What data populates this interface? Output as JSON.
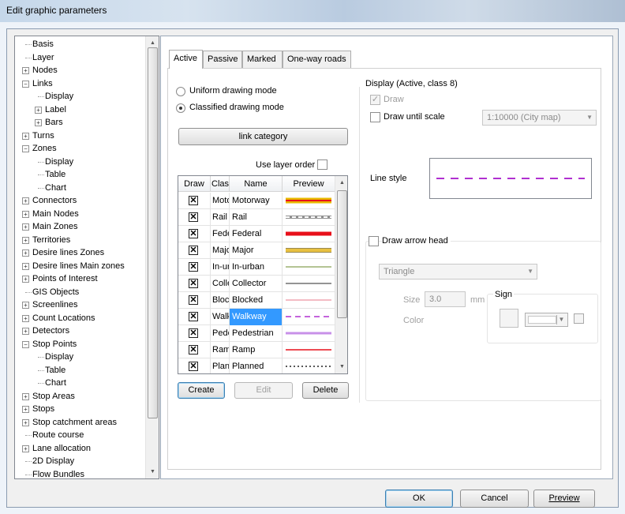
{
  "window": {
    "title": "Edit graphic parameters"
  },
  "tree": {
    "items": [
      {
        "label": "Basis",
        "level": 1,
        "expander": "none"
      },
      {
        "label": "Layer",
        "level": 1,
        "expander": "none"
      },
      {
        "label": "Nodes",
        "level": 1,
        "expander": "plus"
      },
      {
        "label": "Links",
        "level": 1,
        "expander": "minus"
      },
      {
        "label": "Display",
        "level": 2,
        "expander": "none"
      },
      {
        "label": "Label",
        "level": 2,
        "expander": "plus"
      },
      {
        "label": "Bars",
        "level": 2,
        "expander": "plus"
      },
      {
        "label": "Turns",
        "level": 1,
        "expander": "plus"
      },
      {
        "label": "Zones",
        "level": 1,
        "expander": "minus"
      },
      {
        "label": "Display",
        "level": 2,
        "expander": "none"
      },
      {
        "label": "Table",
        "level": 2,
        "expander": "none"
      },
      {
        "label": "Chart",
        "level": 2,
        "expander": "none"
      },
      {
        "label": "Connectors",
        "level": 1,
        "expander": "plus"
      },
      {
        "label": "Main Nodes",
        "level": 1,
        "expander": "plus"
      },
      {
        "label": "Main Zones",
        "level": 1,
        "expander": "plus"
      },
      {
        "label": "Territories",
        "level": 1,
        "expander": "plus"
      },
      {
        "label": "Desire lines Zones",
        "level": 1,
        "expander": "plus"
      },
      {
        "label": "Desire lines Main zones",
        "level": 1,
        "expander": "plus"
      },
      {
        "label": "Points of Interest",
        "level": 1,
        "expander": "plus"
      },
      {
        "label": "GIS Objects",
        "level": 1,
        "expander": "none"
      },
      {
        "label": "Screenlines",
        "level": 1,
        "expander": "plus"
      },
      {
        "label": "Count Locations",
        "level": 1,
        "expander": "plus"
      },
      {
        "label": "Detectors",
        "level": 1,
        "expander": "plus"
      },
      {
        "label": "Stop Points",
        "level": 1,
        "expander": "minus"
      },
      {
        "label": "Display",
        "level": 2,
        "expander": "none"
      },
      {
        "label": "Table",
        "level": 2,
        "expander": "none"
      },
      {
        "label": "Chart",
        "level": 2,
        "expander": "none"
      },
      {
        "label": "Stop Areas",
        "level": 1,
        "expander": "plus"
      },
      {
        "label": "Stops",
        "level": 1,
        "expander": "plus"
      },
      {
        "label": "Stop catchment areas",
        "level": 1,
        "expander": "plus"
      },
      {
        "label": "Route course",
        "level": 1,
        "expander": "none"
      },
      {
        "label": "Lane allocation",
        "level": 1,
        "expander": "plus"
      },
      {
        "label": "2D Display",
        "level": 1,
        "expander": "none"
      },
      {
        "label": "Flow Bundles",
        "level": 1,
        "expander": "none"
      }
    ]
  },
  "tabs": [
    {
      "label": "Active",
      "active": true
    },
    {
      "label": "Passive",
      "active": false
    },
    {
      "label": "Marked",
      "active": false
    },
    {
      "label": "One-way roads",
      "active": false
    }
  ],
  "mode": {
    "uniform_label": "Uniform drawing mode",
    "classified_label": "Classified drawing mode",
    "selected": "classified"
  },
  "link_category_button": "link category",
  "use_layer_order": {
    "label": "Use layer order",
    "checked": false
  },
  "grid": {
    "headers": {
      "draw": "Draw",
      "class": "Class",
      "name": "Name",
      "preview": "Preview"
    },
    "rows": [
      {
        "draw": true,
        "cls": "Motorway",
        "name": "Motorway",
        "preview": "motorway"
      },
      {
        "draw": true,
        "cls": "Rail",
        "name": "Rail",
        "preview": "rail"
      },
      {
        "draw": true,
        "cls": "Federal",
        "name": "Federal",
        "preview": "federal"
      },
      {
        "draw": true,
        "cls": "Major",
        "name": "Major",
        "preview": "major"
      },
      {
        "draw": true,
        "cls": "In-urban",
        "name": "In-urban",
        "preview": "inurban"
      },
      {
        "draw": true,
        "cls": "Collector",
        "name": "Collector",
        "preview": "collector"
      },
      {
        "draw": true,
        "cls": "Blocked",
        "name": "Blocked",
        "preview": "blocked"
      },
      {
        "draw": true,
        "cls": "Walkway",
        "name": "Walkway",
        "preview": "walkway",
        "selected": true
      },
      {
        "draw": true,
        "cls": "Pedestrian",
        "name": "Pedestrian",
        "preview": "pedestrian"
      },
      {
        "draw": true,
        "cls": "Ramp",
        "name": "Ramp",
        "preview": "ramp"
      },
      {
        "draw": true,
        "cls": "Planned",
        "name": "Planned",
        "preview": "planned"
      }
    ],
    "preview_colors": {
      "motorway_outer": "#e8b800",
      "motorway_inner": "#e8101a",
      "rail": "#909090",
      "federal": "#e8101a",
      "major": "#e8c040",
      "inurban": "#6a8a2a",
      "collector": "#2a2a2a",
      "blocked": "#e87a8a",
      "walkway": "#b030d0",
      "pedestrian": "#c890e8",
      "ramp": "#e8101a",
      "planned": "#222222"
    }
  },
  "grid_buttons": {
    "create": "Create",
    "edit": "Edit",
    "delete": "Delete"
  },
  "display": {
    "heading": "Display (Active, class 8)",
    "draw_label": "Draw",
    "draw_checked": true,
    "draw_until_scale_label": "Draw until scale",
    "draw_until_scale_checked": false,
    "scale_value": "1:10000 (City map)",
    "line_style_label": "Line style",
    "line_style_color": "#b030d0",
    "draw_arrow_head_label": "Draw arrow head",
    "draw_arrow_head_checked": false,
    "arrow_shape": "Triangle",
    "size_label": "Size",
    "size_value": "3.0",
    "size_unit": "mm",
    "color_label": "Color",
    "sign_label": "Sign"
  },
  "footer": {
    "ok": "OK",
    "cancel": "Cancel",
    "preview": "Preview"
  }
}
